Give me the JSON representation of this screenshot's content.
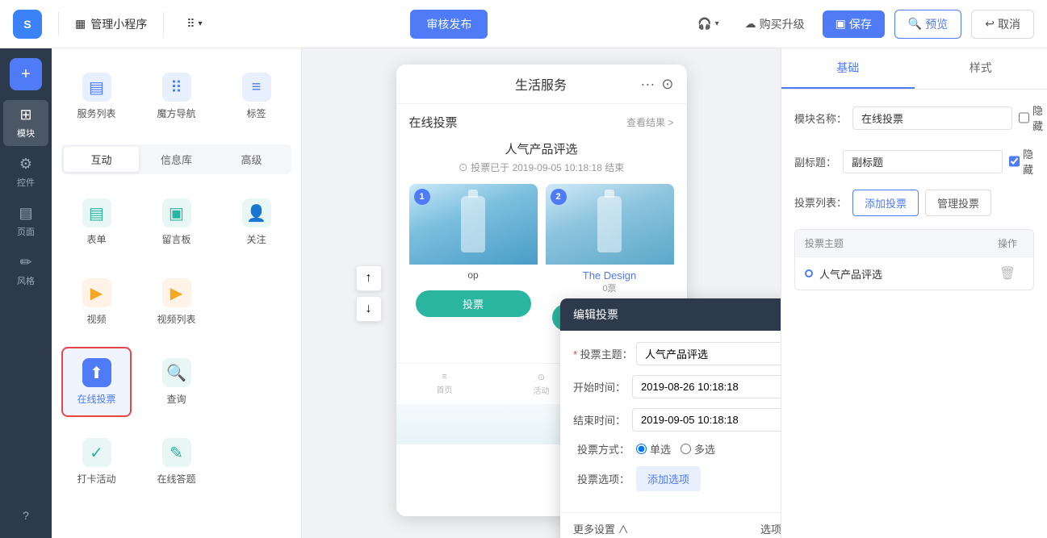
{
  "topbar": {
    "logo_text": "S",
    "manage_label": "管理小程序",
    "grid_label": "",
    "publish_label": "审核发布",
    "headset_label": "",
    "upgrade_label": "购买升级",
    "save_label": "保存",
    "preview_label": "预览",
    "cancel_label": "取消"
  },
  "sidebar": {
    "items": [
      {
        "label": "模块",
        "icon": "⊞",
        "active": true
      },
      {
        "label": "控件",
        "icon": "⚙",
        "active": false
      },
      {
        "label": "页面",
        "icon": "▤",
        "active": false
      },
      {
        "label": "风格",
        "icon": "✏",
        "active": false
      }
    ],
    "add_label": "+",
    "help_label": "?"
  },
  "module_panel": {
    "modules_row1": [
      {
        "label": "服务列表",
        "icon": "▤",
        "color": "blue"
      },
      {
        "label": "魔方导航",
        "icon": "⠿",
        "color": "blue"
      },
      {
        "label": "标签",
        "icon": "≡",
        "color": "blue"
      }
    ],
    "tabs": [
      {
        "label": "互动",
        "active": true
      },
      {
        "label": "信息库",
        "active": false
      },
      {
        "label": "高级",
        "active": false
      }
    ],
    "modules_row2": [
      {
        "label": "表单",
        "icon": "▤",
        "color": "teal"
      },
      {
        "label": "留言板",
        "icon": "▣",
        "color": "teal"
      },
      {
        "label": "关注",
        "icon": "👤+",
        "color": "teal"
      },
      {
        "label": "视频",
        "icon": "▶",
        "color": "orange"
      },
      {
        "label": "视频列表",
        "icon": "▶≡",
        "color": "orange"
      },
      {
        "label": "",
        "icon": "",
        "color": ""
      },
      {
        "label": "在线投票",
        "icon": "⬆",
        "color": "active-bg",
        "active": true
      },
      {
        "label": "查询",
        "icon": "🔍",
        "color": "teal"
      },
      {
        "label": "",
        "icon": "",
        "color": ""
      },
      {
        "label": "打卡活动",
        "icon": "↓≡",
        "color": "teal"
      },
      {
        "label": "在线答题",
        "icon": "✓",
        "color": "teal"
      },
      {
        "label": "",
        "icon": "",
        "color": ""
      }
    ]
  },
  "phone": {
    "title": "生活服务",
    "vote_section_title": "在线投票",
    "see_result": "查看结果 >",
    "poll_title": "人气产品评选",
    "poll_meta": "⊙ 投票已于 2019-09-05 10:18:18 结束",
    "card1_num": "1",
    "card2_num": "2",
    "card2_name": "The Design",
    "card2_count": "0票",
    "vote_btn_label": "投票",
    "bottom_icons": [
      "≡",
      "⊙",
      "👤"
    ]
  },
  "edit_popup": {
    "title": "编辑投票",
    "vote_theme_label": "投票主题：",
    "vote_theme_value": "人气产品评选",
    "start_time_label": "开始时间：",
    "start_time_value": "2019-08-26 10:18:18",
    "end_time_label": "结束时间：",
    "end_time_value": "2019-09-05 10:18:18",
    "vote_type_label": "投票方式：",
    "radio_single": "单选",
    "radio_multiple": "多选",
    "vote_options_label": "投票选项：",
    "add_option_label": "添加选项",
    "more_settings_label": "更多设置 ∧",
    "more_options_label": "选项"
  },
  "right_panel": {
    "tabs": [
      {
        "label": "基础",
        "active": true
      },
      {
        "label": "样式",
        "active": false
      }
    ],
    "module_name_label": "模块名称：",
    "module_name_value": "在线投票",
    "hide_label": "隐藏",
    "subtitle_label": "副标题：",
    "subtitle_value": "副标题",
    "subtitle_hide": true,
    "vote_list_label": "投票列表：",
    "add_vote_btn": "添加投票",
    "manage_vote_btn": "管理投票",
    "table_header_theme": "投票主题",
    "table_header_action": "操作",
    "table_row1_name": "人气产品评选",
    "delete_icon": "🗑"
  }
}
